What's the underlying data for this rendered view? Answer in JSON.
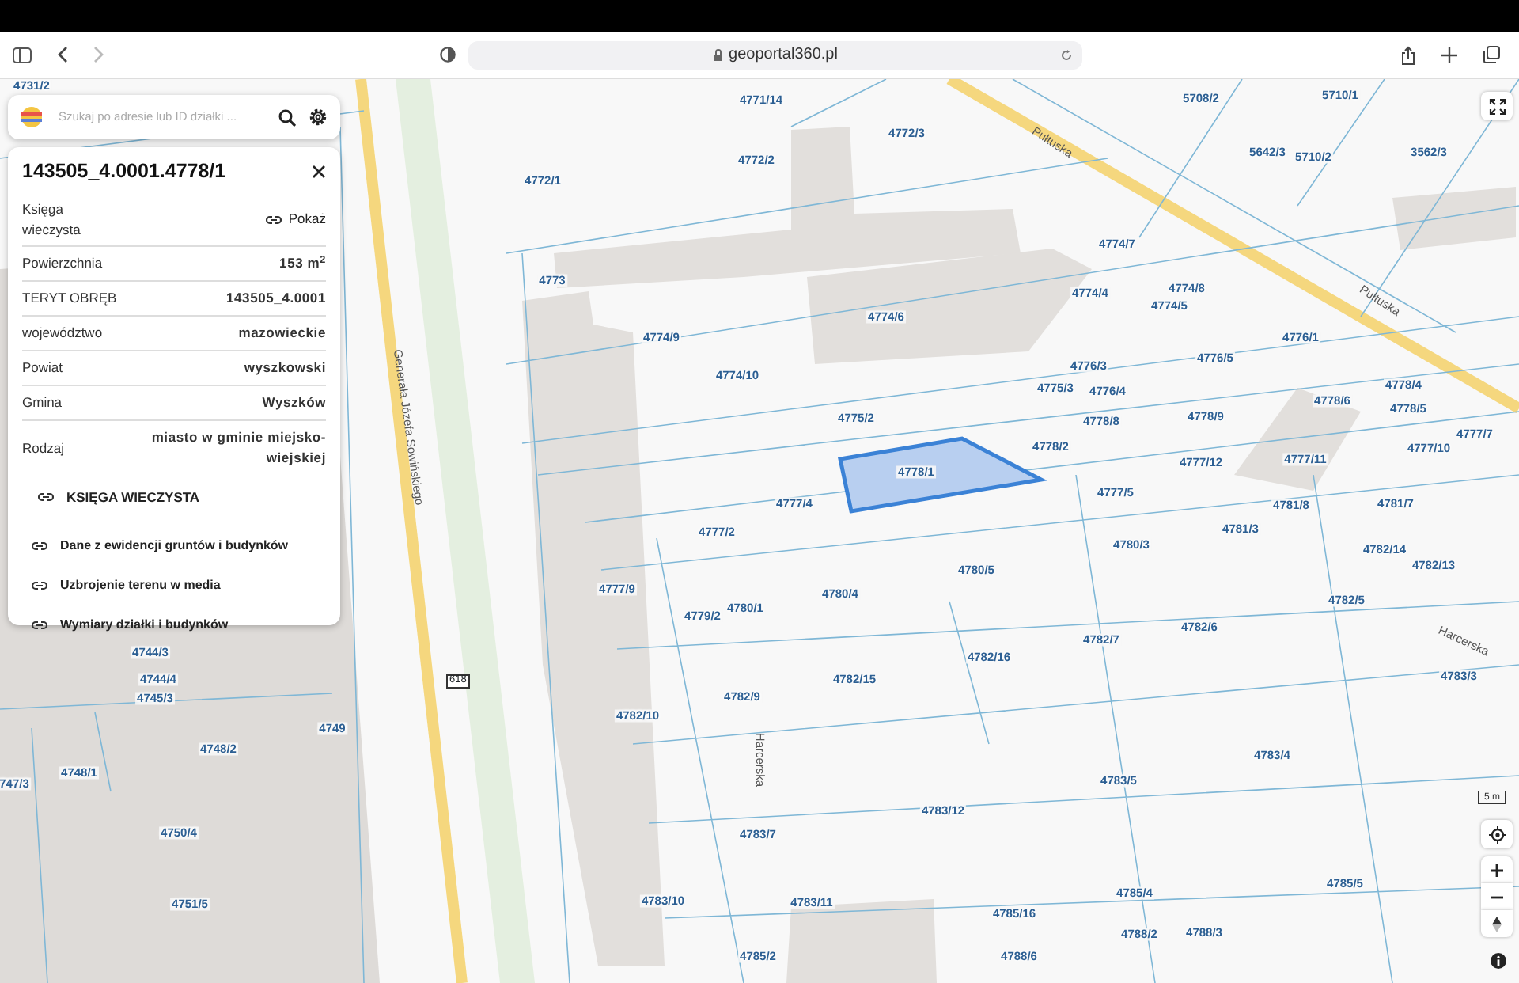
{
  "browser": {
    "url": "geoportal360.pl"
  },
  "search": {
    "placeholder": "Szukaj po adresie lub ID działki ..."
  },
  "parcel": {
    "title": "143505_4.0001.4778/1",
    "rows": [
      {
        "label": "Księga wieczysta",
        "value": "Pokaż",
        "kind": "link"
      },
      {
        "label": "Powierzchnia",
        "value": "153 m$^{2}$",
        "kind": "text"
      },
      {
        "label": "TERYT OBRĘB",
        "value": "143505_4.0001",
        "kind": "text"
      },
      {
        "label": "województwo",
        "value": "mazowieckie",
        "kind": "text"
      },
      {
        "label": "Powiat",
        "value": "wyszkowski",
        "kind": "text"
      },
      {
        "label": "Gmina",
        "value": "Wyszków",
        "kind": "text"
      },
      {
        "label": "Rodzaj",
        "value": "miasto w gminie miejsko-wiejskiej",
        "kind": "text"
      }
    ],
    "links": [
      {
        "label": "KSIĘGA WIECZYSTA",
        "kind": "section"
      },
      {
        "label": "Dane z ewidencji gruntów i budynków",
        "kind": "item"
      },
      {
        "label": "Uzbrojenie terenu w media",
        "kind": "item"
      },
      {
        "label": "Wymiary działki i budynków",
        "kind": "item"
      }
    ]
  },
  "map": {
    "parcel_labels": [
      "4731/2",
      "4744/3",
      "4744/4",
      "4745/3",
      "4749",
      "4748/2",
      "4748/1",
      "747/3",
      "4750/4",
      "4751/5",
      "4771/14",
      "4772/3",
      "4772/2",
      "4772/1",
      "4773",
      "4774/9",
      "4774/10",
      "4774/6",
      "4774/7",
      "4774/4",
      "4774/8",
      "4774/5",
      "4776/1",
      "4776/5",
      "4776/3",
      "4776/4",
      "4775/3",
      "5708/2",
      "5710/1",
      "5642/3",
      "5710/2",
      "3562/3",
      "4778/4",
      "4778/6",
      "4778/5",
      "4775/2",
      "4778/8",
      "4778/9",
      "4777/7",
      "4777/10",
      "4778/2",
      "4778/1",
      "4777/12",
      "4777/11",
      "4777/4",
      "4777/5",
      "4781/8",
      "4781/7",
      "4777/2",
      "4781/3",
      "4780/3",
      "4782/14",
      "4782/13",
      "4780/5",
      "4780/4",
      "4777/9",
      "4779/2",
      "4780/1",
      "4782/5",
      "4782/7",
      "4782/6",
      "4782/16",
      "4782/15",
      "4783/3",
      "4782/9",
      "4782/10",
      "4783/4",
      "4783/5",
      "4783/12",
      "4783/7",
      "4785/5",
      "4785/4",
      "4783/10",
      "4783/11",
      "4785/16",
      "4788/2",
      "4788/3",
      "4785/2",
      "4788/6"
    ],
    "street_labels": [
      "Pułtuska",
      "Pułtuska",
      "Generała Józefa Sowińskiego",
      "Harcerska",
      "Harcerska"
    ],
    "road_number": "618",
    "scale": "5 m"
  }
}
